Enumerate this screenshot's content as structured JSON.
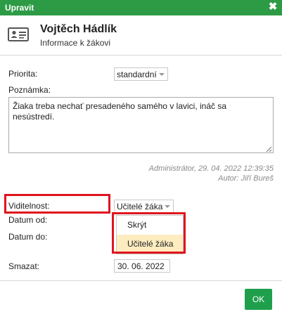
{
  "window": {
    "title": "Upravit",
    "close_icon": "close-icon"
  },
  "header": {
    "name": "Vojtěch Hádlík",
    "subtitle": "Informace k žákovi",
    "icon": "id-card-icon"
  },
  "form": {
    "priority": {
      "label": "Priorita:",
      "value": "standardní"
    },
    "note": {
      "label": "Poznámka:",
      "value": "Žiaka treba nechať presadeného samého v lavici, ináč sa nesústredí."
    },
    "meta": {
      "created": "Administrátor, 29. 04. 2022 12:39:35",
      "author": "Autor: Jiří Bureš"
    },
    "visibility": {
      "label": "Viditelnost:",
      "value": "Učitelé žáka",
      "options": [
        "Skrýt",
        "Učitelé žáka"
      ],
      "selected_option": "Učitelé žáka"
    },
    "date_from": {
      "label": "Datum od:"
    },
    "date_to": {
      "label": "Datum do:"
    },
    "delete": {
      "label": "Smazat:",
      "value": "30. 06. 2022"
    }
  },
  "footer": {
    "ok_label": "OK"
  },
  "colors": {
    "titlebar": "#2d9b45",
    "ok_button": "#1f9f4c",
    "highlight": "#e0141e",
    "selected_option_bg": "#fdecc0",
    "meta_text": "#8a8a8a"
  }
}
